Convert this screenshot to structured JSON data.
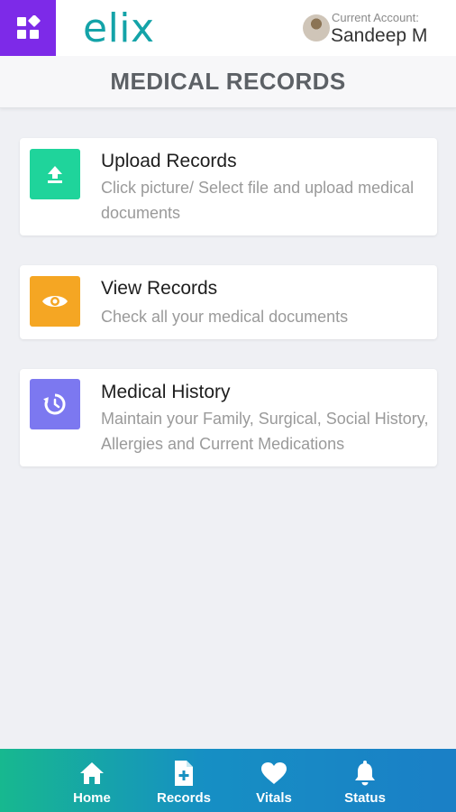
{
  "header": {
    "logo_text": "elix",
    "account_caption": "Current Account:",
    "account_name": "Sandeep M"
  },
  "page": {
    "title": "MEDICAL RECORDS"
  },
  "cards": [
    {
      "title": "Upload Records",
      "description": "Click picture/ Select file and upload medical documents",
      "icon": "upload-icon",
      "color": "#1fd49b"
    },
    {
      "title": "View Records",
      "description": "Check all your medical documents",
      "icon": "eye-icon",
      "color": "#f5a623"
    },
    {
      "title": "Medical History",
      "description": "Maintain your Family, Surgical, Social History, Allergies and Current Medications",
      "icon": "history-icon",
      "color": "#7c78f0"
    }
  ],
  "bottom_nav": {
    "items": [
      {
        "label": "Home",
        "icon": "home-icon"
      },
      {
        "label": "Records",
        "icon": "file-plus-icon"
      },
      {
        "label": "Vitals",
        "icon": "heart-icon"
      },
      {
        "label": "Status",
        "icon": "bell-icon"
      }
    ]
  },
  "colors": {
    "menu_button": "#7d2ae8",
    "logo": "#14a3a8",
    "background": "#eff0f4",
    "bottom_nav_start": "#17b88f",
    "bottom_nav_end": "#1a7fc6"
  }
}
